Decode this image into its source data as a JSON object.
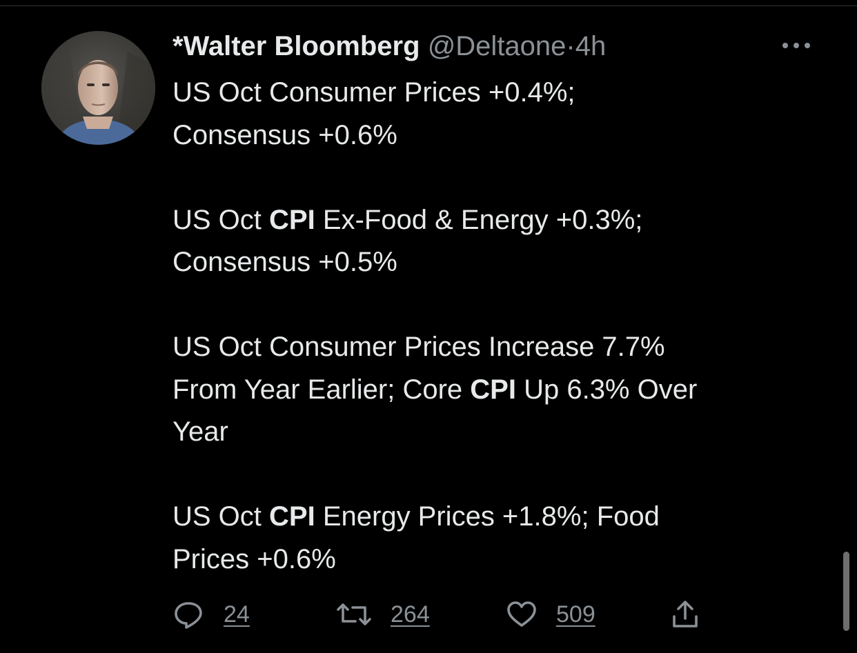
{
  "tweet": {
    "author_name": "*Walter Bloomberg",
    "author_handle": "@Deltaone",
    "separator": "·",
    "timestamp": "4h",
    "more_icon": "more-horizontal-icon",
    "paragraphs": [
      [
        {
          "text": "US Oct Consumer Prices +0.4%;"
        },
        {
          "br": true
        },
        {
          "text": "Consensus +0.6%"
        }
      ],
      [
        {
          "text": "US Oct "
        },
        {
          "text": "CPI",
          "bold": true
        },
        {
          "text": " Ex-Food & Energy +0.3%;"
        },
        {
          "br": true
        },
        {
          "text": "Consensus +0.5%"
        }
      ],
      [
        {
          "text": "US Oct Consumer Prices Increase 7.7%"
        },
        {
          "br": true
        },
        {
          "text": "From Year Earlier; Core "
        },
        {
          "text": "CPI",
          "bold": true
        },
        {
          "text": " Up 6.3% Over"
        },
        {
          "br": true
        },
        {
          "text": "Year"
        }
      ],
      [
        {
          "text": "US Oct "
        },
        {
          "text": "CPI",
          "bold": true
        },
        {
          "text": " Energy Prices +1.8%; Food"
        },
        {
          "br": true
        },
        {
          "text": "Prices +0.6%"
        }
      ]
    ],
    "actions": {
      "reply": {
        "icon": "reply-icon",
        "count": "24"
      },
      "retweet": {
        "icon": "retweet-icon",
        "count": "264"
      },
      "like": {
        "icon": "heart-icon",
        "count": "509"
      },
      "share": {
        "icon": "share-icon"
      }
    }
  },
  "colors": {
    "background": "#000000",
    "text_primary": "#e7e9ea",
    "text_secondary": "#8b9196",
    "divider": "#2f3336"
  }
}
